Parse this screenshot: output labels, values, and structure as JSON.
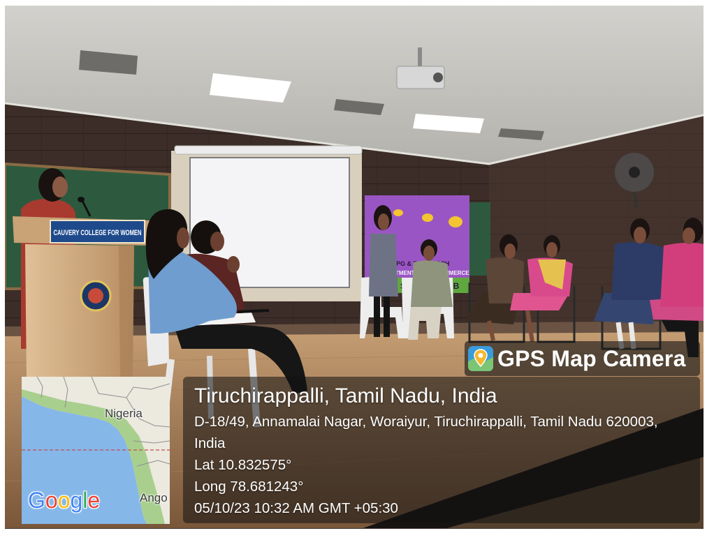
{
  "scene": {
    "podium_sign": "CAUVERY COLLEGE FOR WOMEN",
    "banner": {
      "line1_left": "PG & RE",
      "line1_right": "RCH",
      "line2_left": "TMENT",
      "line2_right": "COMMERCE",
      "line3_left": "SY",
      "line3_right": "UB"
    }
  },
  "badge": {
    "label": "GPS Map Camera",
    "icon": "map-pin-icon"
  },
  "location": {
    "title": "Tiruchirappalli, Tamil Nadu, India",
    "address_line1": "D-18/49, Annamalai Nagar, Woraiyur, Tiruchirappalli, Tamil Nadu 620003,",
    "address_line2": "India",
    "latitude": "Lat 10.832575°",
    "longitude": "Long 78.681243°",
    "datetime": "05/10/23 10:32 AM GMT +05:30"
  },
  "map": {
    "label_country": "Nigeria",
    "label_partial": "Ango",
    "logo": "Google",
    "logo_colors": [
      "#4285F4",
      "#EA4335",
      "#FBBC05",
      "#4285F4",
      "#34A853",
      "#EA4335"
    ],
    "sea_color": "#86b7e9",
    "equator_color": "#c0504d"
  }
}
